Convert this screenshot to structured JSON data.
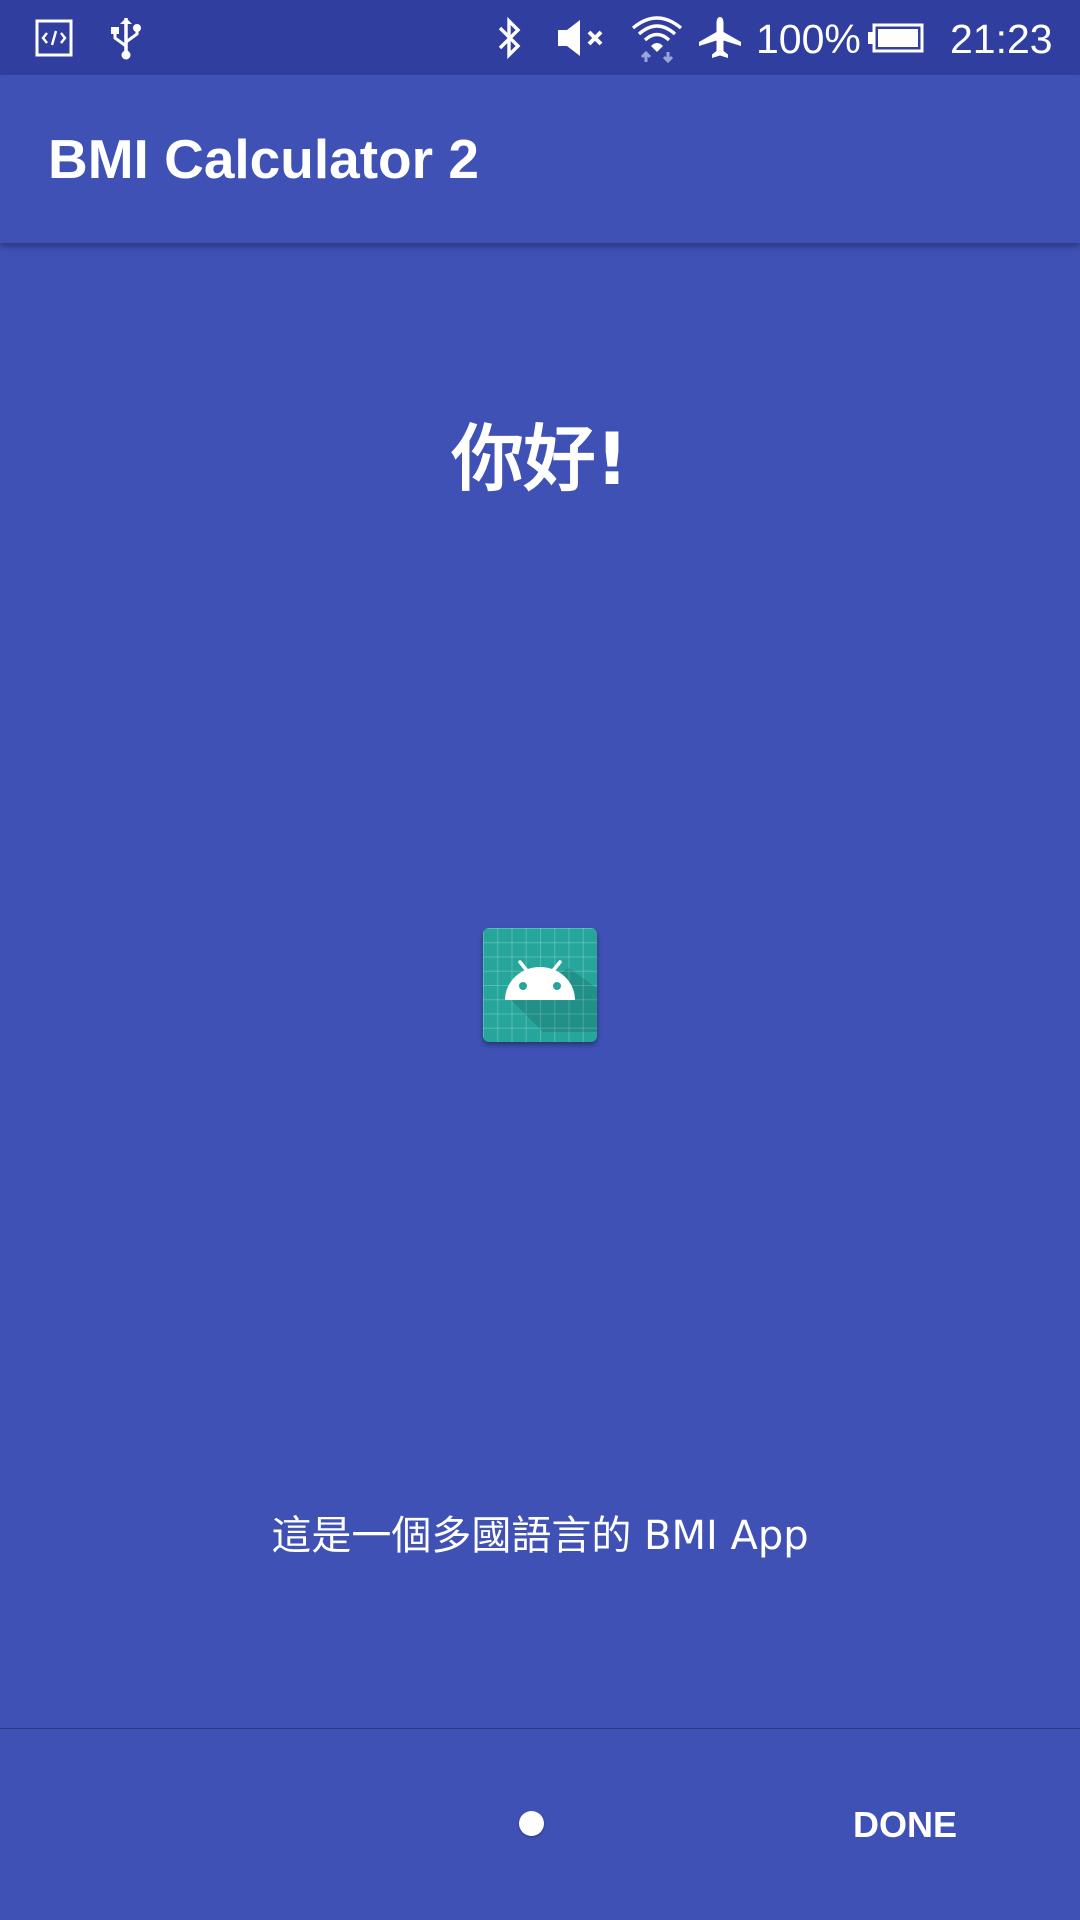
{
  "status_bar": {
    "left_icons": [
      "developer-mode-icon",
      "usb-icon"
    ],
    "right_icons": [
      "bluetooth-icon",
      "volume-muted-icon",
      "wifi-icon",
      "airplane-mode-icon",
      "battery-icon"
    ],
    "battery_percent": "100%",
    "time": "21:23",
    "background_color": "#303f9f"
  },
  "app_bar": {
    "title": "BMI Calculator 2",
    "background_color": "#3f51b5"
  },
  "intro_slide": {
    "greeting": "你好!",
    "icon": "android-app-icon",
    "icon_color": "#26a69a",
    "description": "這是一個多國語言的 BMI App",
    "background_color": "#3f51b5"
  },
  "bottom_bar": {
    "page_indicator_count": 1,
    "page_indicator_active": 1,
    "done_label": "DONE"
  }
}
